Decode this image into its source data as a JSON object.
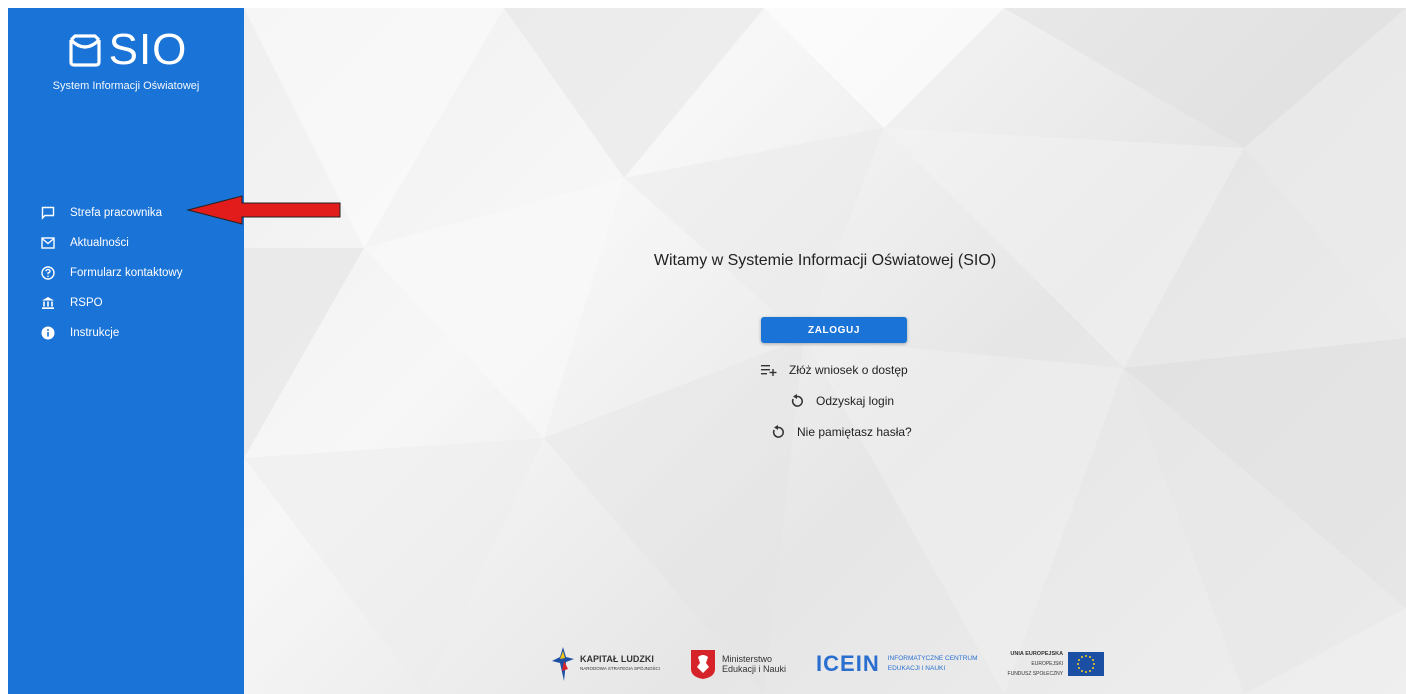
{
  "sidebar": {
    "logo_text": "SIO",
    "subtitle": "System Informacji Oświatowej",
    "items": [
      {
        "label": "Strefa pracownika",
        "icon": "chat-icon"
      },
      {
        "label": "Aktualności",
        "icon": "mail-icon"
      },
      {
        "label": "Formularz kontaktowy",
        "icon": "help-icon"
      },
      {
        "label": "RSPO",
        "icon": "bank-icon"
      },
      {
        "label": "Instrukcje",
        "icon": "info-icon"
      }
    ]
  },
  "main": {
    "welcome": "Witamy w Systemie Informacji Oświatowej (SIO)",
    "login_label": "ZALOGUJ",
    "links": [
      {
        "label": "Złóż wniosek o dostęp",
        "icon": "playlist-add-icon"
      },
      {
        "label": "Odzyskaj login",
        "icon": "refresh-icon"
      },
      {
        "label": "Nie pamiętasz hasła?",
        "icon": "refresh-icon"
      }
    ]
  },
  "footer": {
    "kapital": "KAPITAŁ LUDZKI",
    "kapital_sub": "NARODOWA STRATEGIA SPÓJNOŚCI",
    "ministerstwo_1": "Ministerstwo",
    "ministerstwo_2": "Edukacji i Nauki",
    "icein": "ICEIN",
    "icein_1": "INFORMATYCZNE CENTRUM",
    "icein_2": "EDUKACJI I NAUKI",
    "ue_1": "UNIA EUROPEJSKA",
    "ue_2": "EUROPEJSKI",
    "ue_3": "FUNDUSZ SPOŁECZNY"
  },
  "colors": {
    "brand": "#1a73d6",
    "arrow": "#e21b1b"
  }
}
